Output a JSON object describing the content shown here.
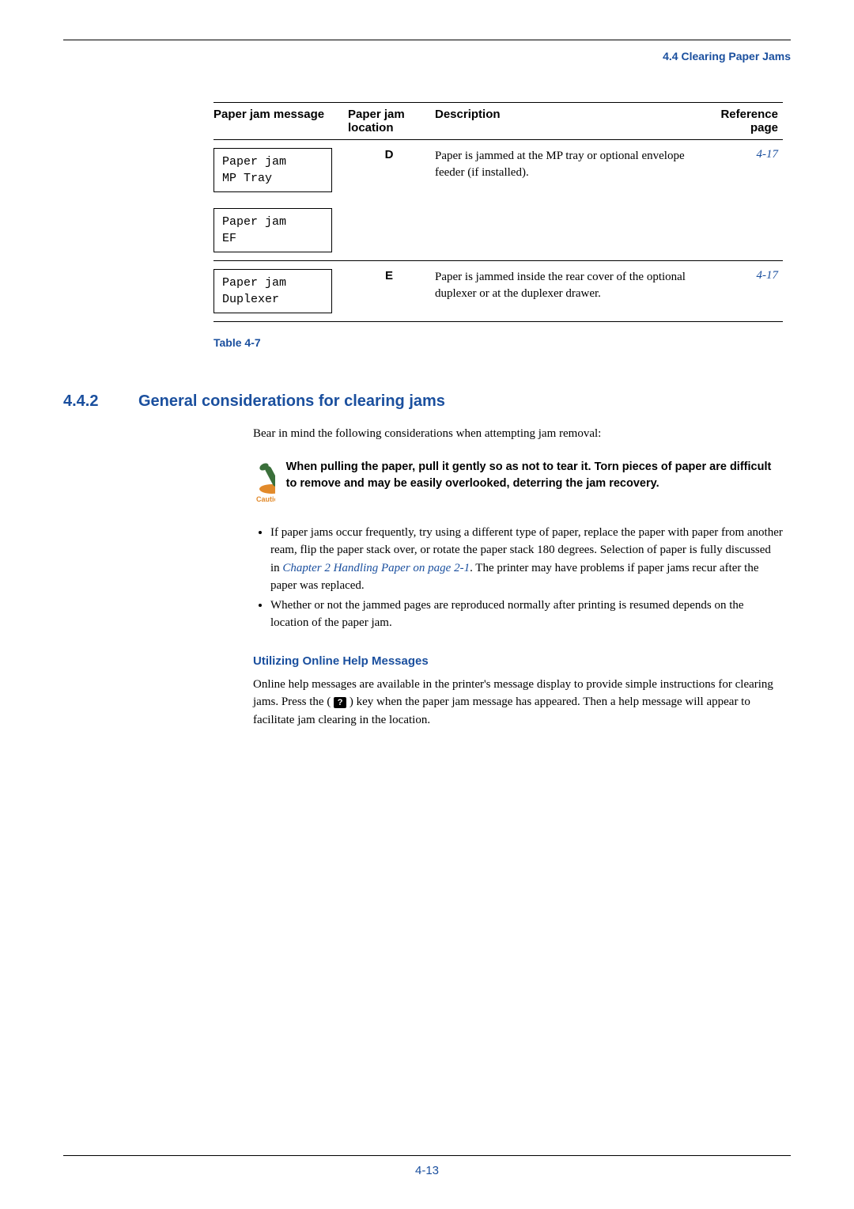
{
  "header": {
    "section_title": "4.4 Clearing Paper Jams"
  },
  "table": {
    "headers": {
      "msg": "Paper jam message",
      "loc": "Paper jam location",
      "desc": "Description",
      "ref": "Reference page"
    },
    "row_d": {
      "msg1_l1": "Paper jam",
      "msg1_l2": "MP Tray",
      "msg2_l1": "Paper jam",
      "msg2_l2": "EF",
      "loc": "D",
      "desc": "Paper is jammed at the MP tray or optional envelope feeder (if installed).",
      "ref": "4-17"
    },
    "row_e": {
      "msg_l1": "Paper jam",
      "msg_l2": "Duplexer",
      "loc": "E",
      "desc": "Paper is jammed inside the rear cover of the optional duplexer or at the duplexer drawer.",
      "ref": "4-17"
    },
    "caption": "Table 4-7"
  },
  "section": {
    "number": "4.4.2",
    "title": "General considerations for clearing jams",
    "intro": "Bear in mind the following considerations when attempting jam removal:"
  },
  "caution": {
    "label": "Caution",
    "text": "When pulling the paper, pull it gently so as not to tear it. Torn pieces of paper are difficult to remove and may be easily overlooked, deterring the jam recovery."
  },
  "bullets": {
    "b1_pre": "If paper jams occur frequently, try using a different type of paper, replace the paper with paper from another ream, flip the paper stack over, or rotate the paper stack 180 degrees. Selection of paper is fully discussed in ",
    "b1_link": "Chapter 2 Handling Paper on page 2-1",
    "b1_post": ". The printer may have problems if paper jams recur after the paper was replaced.",
    "b2": "Whether or not the jammed pages are reproduced normally after printing is resumed depends on the location of the paper jam."
  },
  "helpsub": {
    "title": "Utilizing Online Help Messages",
    "pre": "Online help messages are available in the printer's message display to provide simple instructions for clearing jams. Press the ( ",
    "icon_text": "?",
    "mid": " ) key when the paper jam message has appeared. Then a help message will appear to facilitate jam clearing in the location."
  },
  "footer": {
    "page": "4-13"
  }
}
